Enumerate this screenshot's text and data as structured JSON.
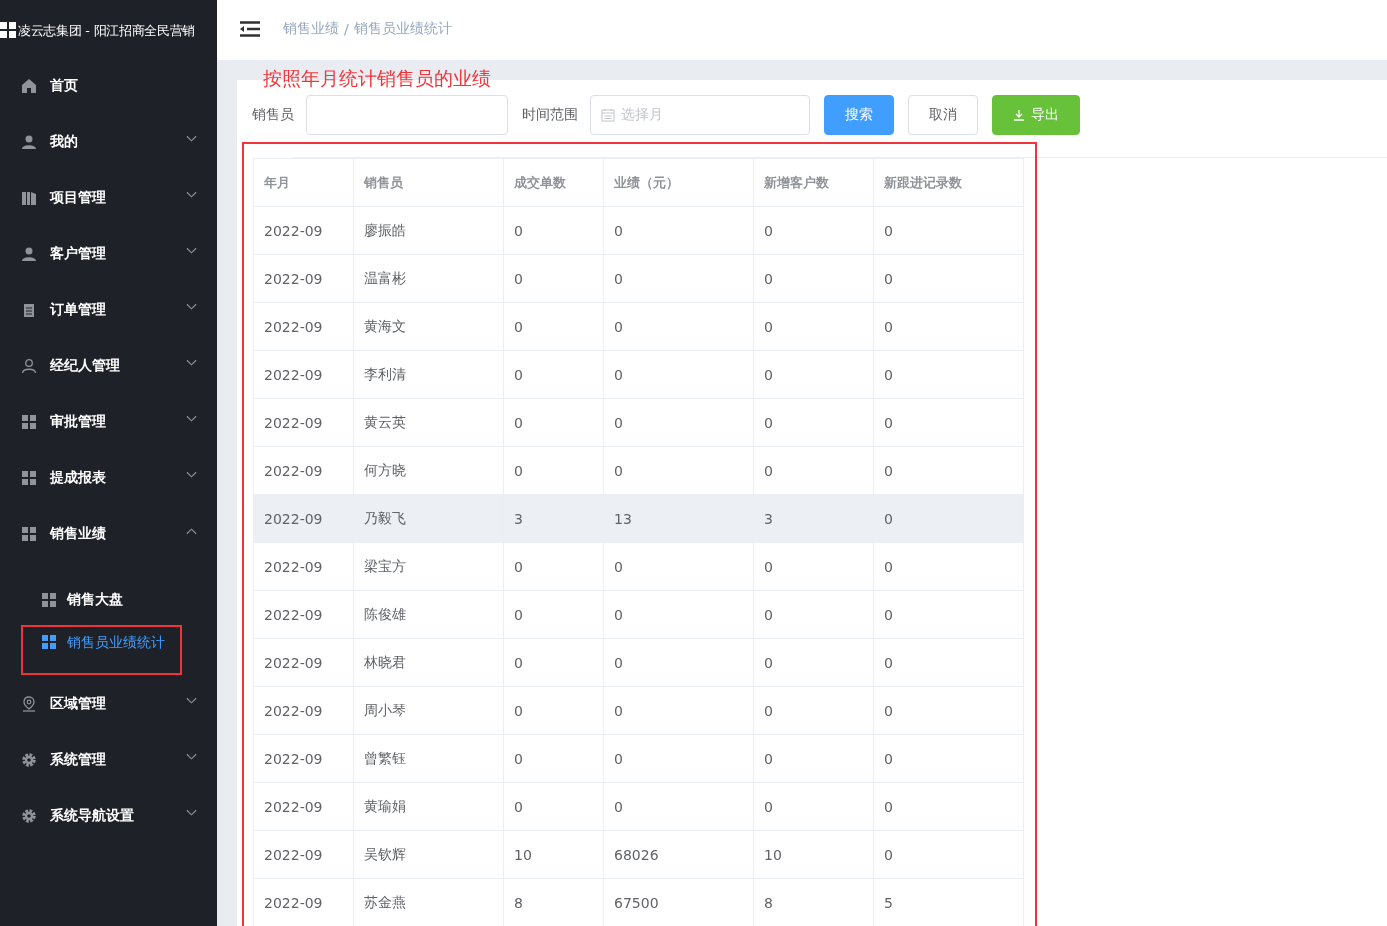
{
  "sidebar": {
    "brand": "凌云志集团 - 阳江招商全民营销",
    "items": [
      {
        "label": "首页",
        "kind": "link"
      },
      {
        "label": "我的",
        "kind": "submenu",
        "expanded": false
      },
      {
        "label": "项目管理",
        "kind": "submenu",
        "expanded": false
      },
      {
        "label": "客户管理",
        "kind": "submenu",
        "expanded": false
      },
      {
        "label": "订单管理",
        "kind": "submenu",
        "expanded": false
      },
      {
        "label": "经纪人管理",
        "kind": "submenu",
        "expanded": false
      },
      {
        "label": "审批管理",
        "kind": "submenu",
        "expanded": false
      },
      {
        "label": "提成报表",
        "kind": "submenu",
        "expanded": false
      },
      {
        "label": "销售业绩",
        "kind": "submenu",
        "expanded": true,
        "children": [
          {
            "label": "销售大盘",
            "selected": false,
            "outlined": false
          },
          {
            "label": "销售员业绩统计",
            "selected": true,
            "outlined": true
          }
        ]
      },
      {
        "label": "区域管理",
        "kind": "submenu",
        "expanded": false
      },
      {
        "label": "系统管理",
        "kind": "submenu",
        "expanded": false
      },
      {
        "label": "系统导航设置",
        "kind": "submenu",
        "expanded": false
      }
    ]
  },
  "header": {
    "breadcrumb": [
      "销售业绩",
      "销售员业绩统计"
    ],
    "separator": "/"
  },
  "annotation": {
    "text": "按照年月统计销售员的业绩"
  },
  "filters": {
    "salesperson": {
      "label": "销售员"
    },
    "date_range": {
      "label": "时间范围",
      "placeholder": "选择月"
    }
  },
  "buttons": [
    {
      "label": "搜索",
      "kind": "primary"
    },
    {
      "label": "取消",
      "kind": "default"
    },
    {
      "label": "导出",
      "kind": "export"
    }
  ],
  "table": {
    "outlined": true,
    "columns": [
      "年月",
      "销售员",
      "成交单数",
      "业绩（元）",
      "新增客户数",
      "新跟进记录数"
    ],
    "rows": [
      {
        "cells": [
          "2022-09",
          "廖振皓",
          "0",
          "0",
          "0",
          "0"
        ],
        "selected": false
      },
      {
        "cells": [
          "2022-09",
          "温富彬",
          "0",
          "0",
          "0",
          "0"
        ],
        "selected": false
      },
      {
        "cells": [
          "2022-09",
          "黄海文",
          "0",
          "0",
          "0",
          "0"
        ],
        "selected": false
      },
      {
        "cells": [
          "2022-09",
          "李利清",
          "0",
          "0",
          "0",
          "0"
        ],
        "selected": false
      },
      {
        "cells": [
          "2022-09",
          "黄云英",
          "0",
          "0",
          "0",
          "0"
        ],
        "selected": false
      },
      {
        "cells": [
          "2022-09",
          "何方晓",
          "0",
          "0",
          "0",
          "0"
        ],
        "selected": false
      },
      {
        "cells": [
          "2022-09",
          "乃毅飞",
          "3",
          "13",
          "3",
          "0"
        ],
        "selected": true
      },
      {
        "cells": [
          "2022-09",
          "梁宝方",
          "0",
          "0",
          "0",
          "0"
        ],
        "selected": false
      },
      {
        "cells": [
          "2022-09",
          "陈俊雄",
          "0",
          "0",
          "0",
          "0"
        ],
        "selected": false
      },
      {
        "cells": [
          "2022-09",
          "林晓君",
          "0",
          "0",
          "0",
          "0"
        ],
        "selected": false
      },
      {
        "cells": [
          "2022-09",
          "周小琴",
          "0",
          "0",
          "0",
          "0"
        ],
        "selected": false
      },
      {
        "cells": [
          "2022-09",
          "曾繁钰",
          "0",
          "0",
          "0",
          "0"
        ],
        "selected": false
      },
      {
        "cells": [
          "2022-09",
          "黄瑜娟",
          "0",
          "0",
          "0",
          "0"
        ],
        "selected": false
      },
      {
        "cells": [
          "2022-09",
          "吴钦辉",
          "10",
          "68026",
          "10",
          "0"
        ],
        "selected": false
      },
      {
        "cells": [
          "2022-09",
          "苏金燕",
          "8",
          "67500",
          "8",
          "5"
        ],
        "selected": false
      }
    ]
  }
}
